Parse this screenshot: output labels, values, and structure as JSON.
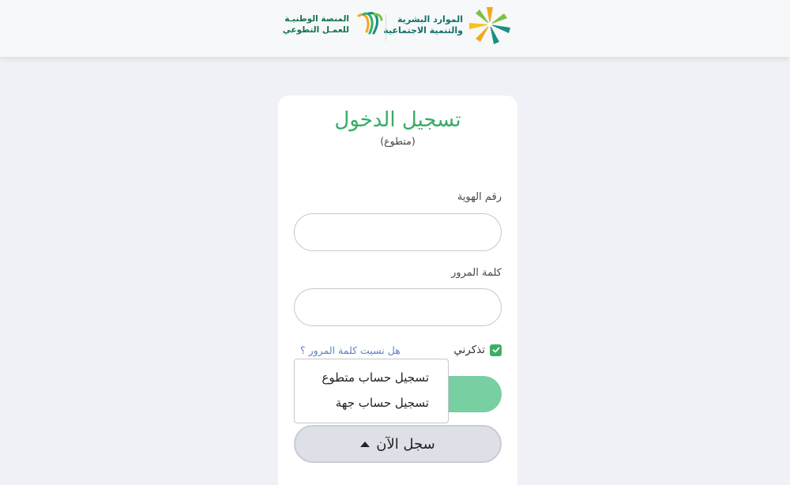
{
  "header": {
    "ministry_logo": {
      "line1": "الموارد البشرية",
      "line2": "والتنمية الاجتماعية"
    },
    "platform_logo": {
      "line1": "المنصة الوطنيـة",
      "line2": "للعمـل التطوعي"
    }
  },
  "login": {
    "title": "تسجيل الدخول",
    "subtitle": "(متطوع)",
    "id_label": "رقم الهوية",
    "id_value": "",
    "password_label": "كلمة المرور",
    "password_value": "",
    "remember_label": "تذكرني",
    "remember_checked": true,
    "forgot_link": "هل نسيت كلمة المرور ؟",
    "register_button": "سجل الآن",
    "register_menu": [
      "تسجيل حساب متطوع",
      "تسجيل حساب جهة"
    ]
  },
  "colors": {
    "accent_green": "#36ac67",
    "button_green": "#77cfa2",
    "link_blue": "#5b84c4",
    "background": "#eff1f6"
  },
  "icons": [
    "hrsd-star-icon",
    "nvp-logo-icon",
    "check-icon",
    "caret-up-icon"
  ]
}
